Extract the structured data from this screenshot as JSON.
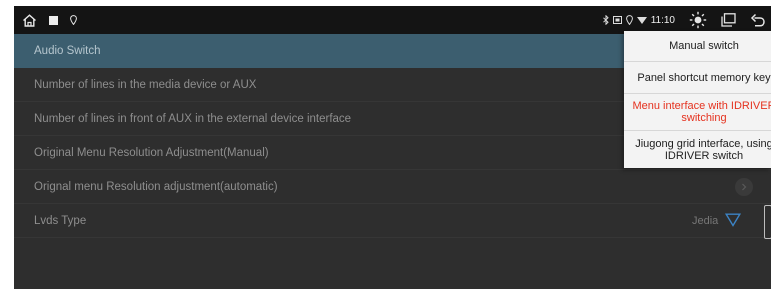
{
  "status_bar": {
    "time": "11:10",
    "icons": [
      "home-icon",
      "square-icon",
      "location-pin-icon",
      "bluetooth-icon",
      "sim-card-icon",
      "location-icon",
      "wifi-icon",
      "brightness-icon",
      "recent-apps-icon",
      "back-icon"
    ]
  },
  "settings_list": {
    "items": [
      {
        "label": "Audio Switch",
        "selected": true
      },
      {
        "label": "Number of lines in the media device or AUX"
      },
      {
        "label": "Number of lines in front of AUX in the external device interface"
      },
      {
        "label": "Original Menu Resolution Adjustment(Manual)"
      },
      {
        "label": "Orignal menu Resolution adjustment(automatic)"
      },
      {
        "label": "Lvds Type",
        "value": "Jedia"
      }
    ]
  },
  "dropdown": {
    "options": [
      {
        "lines": [
          "Manual switch"
        ]
      },
      {
        "lines": [
          "Panel shortcut memory key"
        ]
      },
      {
        "lines": [
          "Menu interface with IDRIVER",
          "switching"
        ],
        "highlighted": true
      },
      {
        "lines": [
          "Jiugong grid interface, using",
          "IDRIVER switch"
        ]
      }
    ]
  },
  "colors": {
    "selected_row": "#3c5e6f",
    "highlight_text": "#e5321f",
    "accent_triangle": "#3c83c4"
  }
}
